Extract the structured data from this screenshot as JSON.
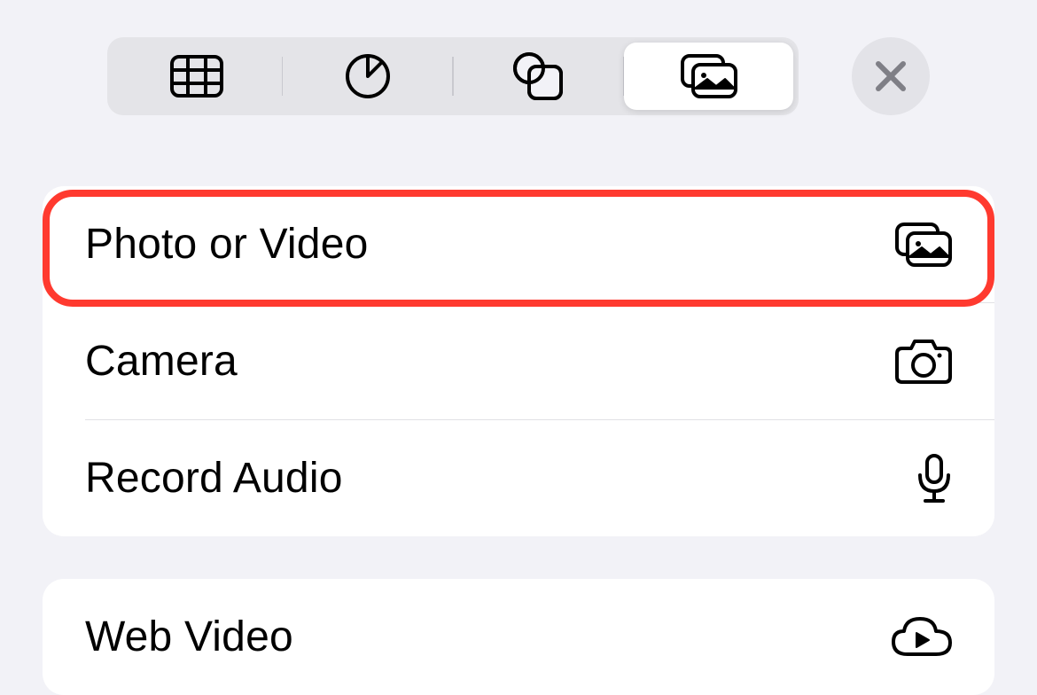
{
  "toolbar": {
    "segments": [
      {
        "name": "table",
        "selected": false
      },
      {
        "name": "chart",
        "selected": false
      },
      {
        "name": "shape",
        "selected": false
      },
      {
        "name": "media",
        "selected": true
      }
    ],
    "close_label": "Close"
  },
  "sections": [
    {
      "items": [
        {
          "label": "Photo or Video",
          "icon": "photo-stack",
          "highlighted": true
        },
        {
          "label": "Camera",
          "icon": "camera"
        },
        {
          "label": "Record Audio",
          "icon": "microphone"
        }
      ]
    },
    {
      "items": [
        {
          "label": "Web Video",
          "icon": "cloud-play"
        }
      ]
    }
  ]
}
